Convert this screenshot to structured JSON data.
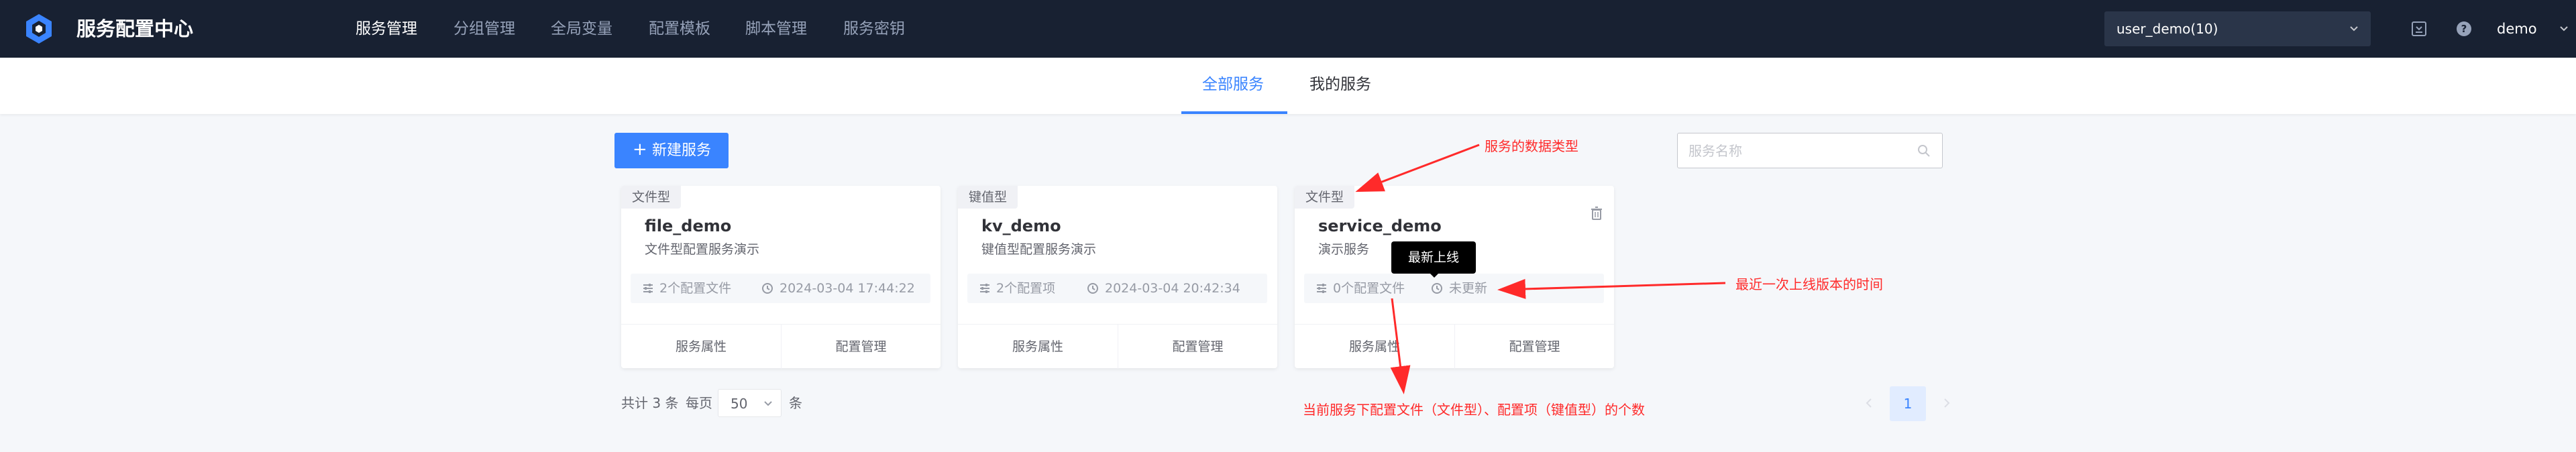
{
  "app": {
    "title": "服务配置中心"
  },
  "nav": {
    "items": [
      {
        "label": "服务管理",
        "active": true
      },
      {
        "label": "分组管理",
        "active": false
      },
      {
        "label": "全局变量",
        "active": false
      },
      {
        "label": "配置模板",
        "active": false
      },
      {
        "label": "脚本管理",
        "active": false
      },
      {
        "label": "服务密钥",
        "active": false
      }
    ]
  },
  "header": {
    "business_select": "user_demo(10)",
    "user": "demo"
  },
  "tabs": [
    {
      "label": "全部服务",
      "active": true
    },
    {
      "label": "我的服务",
      "active": false
    }
  ],
  "toolbar": {
    "new_button_label": "新建服务",
    "search_placeholder": "服务名称"
  },
  "services": [
    {
      "type": "文件型",
      "name": "file_demo",
      "description": "文件型配置服务演示",
      "config_count_text": "2个配置文件",
      "last_release": "2024-03-04 17:44:22",
      "actions": [
        "服务属性",
        "配置管理"
      ]
    },
    {
      "type": "键值型",
      "name": "kv_demo",
      "description": "键值型配置服务演示",
      "config_count_text": "2个配置项",
      "last_release": "2024-03-04 20:42:34",
      "actions": [
        "服务属性",
        "配置管理"
      ]
    },
    {
      "type": "文件型",
      "name": "service_demo",
      "description": "演示服务",
      "config_count_text": "0个配置文件",
      "last_release": "未更新",
      "actions": [
        "服务属性",
        "配置管理"
      ]
    }
  ],
  "tooltip": {
    "text": "最新上线"
  },
  "pagination": {
    "total_text": "共计 3 条",
    "per_page_label": "每页",
    "per_page_value": "50",
    "per_page_unit": "条",
    "current_page": "1"
  },
  "annotations": {
    "data_type": "服务的数据类型",
    "last_release": "最近一次上线版本的时间",
    "config_count": "当前服务下配置文件（文件型）、配置项（键值型）的个数"
  },
  "colors": {
    "topbar": "#182132",
    "accent": "#3a84ff",
    "annotation": "#ff2a2a"
  }
}
